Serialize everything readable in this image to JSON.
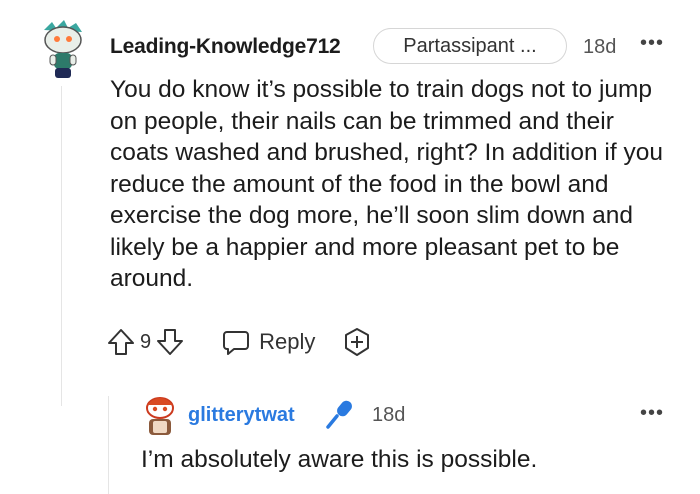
{
  "comment": {
    "username": "Leading-Knowledge712",
    "flair": "Partassipant ...",
    "timestamp": "18d",
    "more": "•••",
    "body": "You do know it’s possible to train dogs not to jump on people, their nails can be trimmed and their coats washed and brushed, right? In addition if you reduce the amount of the food in the bowl and exercise the dog more, he’ll soon slim down and likely be a happier and more pleasant pet to be around.",
    "votes": "9",
    "reply_label": "Reply",
    "avatar_icon": "snoo-avatar-icon"
  },
  "reply": {
    "username": "glitterytwat",
    "timestamp": "18d",
    "more": "•••",
    "body": "I’m absolutely aware this is possible.",
    "badge_icon": "microphone-icon",
    "username_color": "#2a7ae0"
  }
}
